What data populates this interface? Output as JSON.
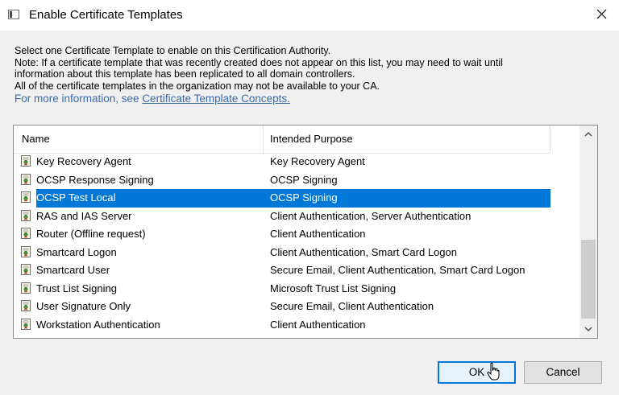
{
  "window": {
    "title": "Enable Certificate Templates",
    "icon": "dialog-window-icon",
    "close_icon": "close-icon"
  },
  "info": {
    "line1": "Select one Certificate Template to enable on this Certification Authority.",
    "line2": "Note: If a certificate template that was recently created does not appear on this list, you may need to wait until",
    "line3": "information about this template has been replicated to all domain controllers.",
    "line4": "All of the certificate templates in the organization may not be available to your CA.",
    "more_prefix": "For more information, see ",
    "more_link": "Certificate Template Concepts."
  },
  "list": {
    "columns": [
      "Name",
      "Intended Purpose"
    ],
    "row_icon": "certificate-template-icon",
    "rows": [
      {
        "name": "Key Recovery Agent",
        "purpose": "Key Recovery Agent",
        "selected": false
      },
      {
        "name": "OCSP Response Signing",
        "purpose": "OCSP Signing",
        "selected": false
      },
      {
        "name": "OCSP Test Local",
        "purpose": "OCSP Signing",
        "selected": true
      },
      {
        "name": "RAS and IAS Server",
        "purpose": "Client Authentication, Server Authentication",
        "selected": false
      },
      {
        "name": "Router (Offline request)",
        "purpose": "Client Authentication",
        "selected": false
      },
      {
        "name": "Smartcard Logon",
        "purpose": "Client Authentication, Smart Card Logon",
        "selected": false
      },
      {
        "name": "Smartcard User",
        "purpose": "Secure Email, Client Authentication, Smart Card Logon",
        "selected": false
      },
      {
        "name": "Trust List Signing",
        "purpose": "Microsoft Trust List Signing",
        "selected": false
      },
      {
        "name": "User Signature Only",
        "purpose": "Secure Email, Client Authentication",
        "selected": false
      },
      {
        "name": "Workstation Authentication",
        "purpose": "Client Authentication",
        "selected": false
      }
    ]
  },
  "buttons": {
    "ok": "OK",
    "cancel": "Cancel"
  },
  "colors": {
    "selection": "#0078d7",
    "link": "#3b6aa8"
  }
}
